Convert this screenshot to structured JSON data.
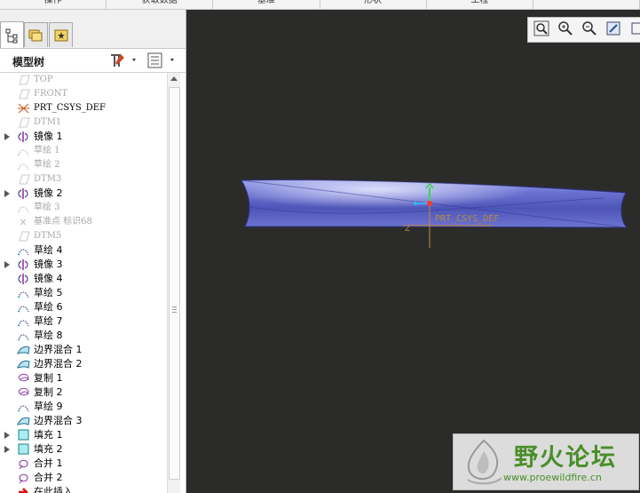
{
  "top_tabs": [
    "操作",
    "获取数据",
    "基准",
    "形状",
    "工程",
    ""
  ],
  "panel": {
    "title": "模型树"
  },
  "tree": [
    {
      "label": "TOP",
      "icon": "datum-plane",
      "dim": true,
      "mono": true,
      "expand": false
    },
    {
      "label": "FRONT",
      "icon": "datum-plane",
      "dim": true,
      "mono": true,
      "expand": false
    },
    {
      "label": "PRT_CSYS_DEF",
      "icon": "coordinate-system",
      "dim": false,
      "mono": true,
      "expand": false
    },
    {
      "label": "DTM1",
      "icon": "datum-plane",
      "dim": true,
      "mono": true,
      "expand": false
    },
    {
      "label": "镜像 1",
      "icon": "mirror",
      "dim": false,
      "mono": false,
      "expand": true
    },
    {
      "label": "草绘 1",
      "icon": "sketch",
      "dim": true,
      "mono": false,
      "expand": false
    },
    {
      "label": "草绘 2",
      "icon": "sketch",
      "dim": true,
      "mono": false,
      "expand": false
    },
    {
      "label": "DTM3",
      "icon": "datum-plane",
      "dim": true,
      "mono": true,
      "expand": false
    },
    {
      "label": "镜像 2",
      "icon": "mirror",
      "dim": false,
      "mono": false,
      "expand": true
    },
    {
      "label": "草绘 3",
      "icon": "sketch",
      "dim": true,
      "mono": false,
      "expand": false
    },
    {
      "label": "基准点 标识68",
      "icon": "datum-point",
      "dim": true,
      "mono": false,
      "expand": false
    },
    {
      "label": "DTM5",
      "icon": "datum-plane",
      "dim": true,
      "mono": true,
      "expand": false
    },
    {
      "label": "草绘 4",
      "icon": "sketch",
      "dim": false,
      "mono": false,
      "expand": false
    },
    {
      "label": "镜像 3",
      "icon": "mirror",
      "dim": false,
      "mono": false,
      "expand": true
    },
    {
      "label": "镜像 4",
      "icon": "mirror",
      "dim": false,
      "mono": false,
      "expand": false
    },
    {
      "label": "草绘 5",
      "icon": "sketch",
      "dim": false,
      "mono": false,
      "expand": false
    },
    {
      "label": "草绘 6",
      "icon": "sketch",
      "dim": false,
      "mono": false,
      "expand": false
    },
    {
      "label": "草绘 7",
      "icon": "sketch",
      "dim": false,
      "mono": false,
      "expand": false
    },
    {
      "label": "草绘 8",
      "icon": "sketch",
      "dim": false,
      "mono": false,
      "expand": false
    },
    {
      "label": "边界混合 1",
      "icon": "boundary-blend",
      "dim": false,
      "mono": false,
      "expand": false
    },
    {
      "label": "边界混合 2",
      "icon": "boundary-blend",
      "dim": false,
      "mono": false,
      "expand": false
    },
    {
      "label": "复制 1",
      "icon": "copy",
      "dim": false,
      "mono": false,
      "expand": false
    },
    {
      "label": "复制 2",
      "icon": "copy",
      "dim": false,
      "mono": false,
      "expand": false
    },
    {
      "label": "草绘 9",
      "icon": "sketch",
      "dim": false,
      "mono": false,
      "expand": false
    },
    {
      "label": "边界混合 3",
      "icon": "boundary-blend",
      "dim": false,
      "mono": false,
      "expand": false
    },
    {
      "label": "填充 1",
      "icon": "fill",
      "dim": false,
      "mono": false,
      "expand": true
    },
    {
      "label": "填充 2",
      "icon": "fill",
      "dim": false,
      "mono": false,
      "expand": true
    },
    {
      "label": "合并 1",
      "icon": "merge",
      "dim": false,
      "mono": false,
      "expand": false
    },
    {
      "label": "合并 2",
      "icon": "merge",
      "dim": false,
      "mono": false,
      "expand": false
    },
    {
      "label": "在此插入",
      "icon": "insert-here",
      "dim": false,
      "mono": false,
      "expand": false
    }
  ],
  "viewport": {
    "csys_label": "PRT_CSYS_DEF",
    "axis_z": "Z",
    "model_color": "#5a63c8"
  },
  "view_toolbar": [
    "zoom-fit-icon",
    "zoom-in-icon",
    "zoom-out-icon",
    "repaint-icon",
    "view-icon"
  ],
  "watermark": {
    "title": "野火论坛",
    "url": "www.proewildfire.cn"
  }
}
